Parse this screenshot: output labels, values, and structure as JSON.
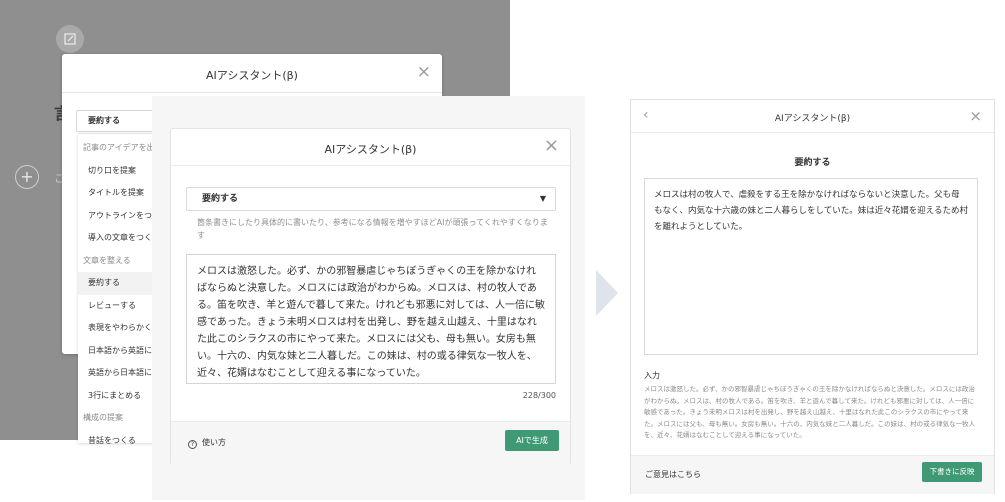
{
  "back": {
    "modal_title": "AIアシスタント(β)",
    "close": "×",
    "plus": "+",
    "editor_char": "言",
    "editor_char2": "こ",
    "select_value": "要約する",
    "dropdown": [
      {
        "type": "head",
        "label": "記事のアイデアを出す"
      },
      {
        "type": "item",
        "label": "切り口を提案"
      },
      {
        "type": "item",
        "label": "タイトルを提案"
      },
      {
        "type": "item",
        "label": "アウトラインをつくる"
      },
      {
        "type": "item",
        "label": "導入の文章をつくる"
      },
      {
        "type": "head",
        "label": "文章を整える"
      },
      {
        "type": "item",
        "label": "要約する",
        "active": true
      },
      {
        "type": "item",
        "label": "レビューする"
      },
      {
        "type": "item",
        "label": "表現をやわらかくする"
      },
      {
        "type": "item",
        "label": "日本語から英語に翻訳"
      },
      {
        "type": "item",
        "label": "英語から日本語に翻訳"
      },
      {
        "type": "item",
        "label": "3行にまとめる"
      },
      {
        "type": "head",
        "label": "構成の提案"
      },
      {
        "type": "item",
        "label": "昔話をつくる"
      }
    ]
  },
  "middle": {
    "title": "AIアシスタント(β)",
    "close": "×",
    "select_value": "要約する",
    "hint": "箇条書きにしたり具体的に書いたり、参考になる情報を増やすほどAIが頑張ってくれやすくなります",
    "input_text": "メロスは激怒した。必ず、かの邪智暴虐じゃちぼうぎゃくの王を除かなければならぬと決意した。メロスには政治がわからぬ。メロスは、村の牧人である。笛を吹き、羊と遊んで暮して来た。けれども邪悪に対しては、人一倍に敏感であった。きょう未明メロスは村を出発し、野を越え山越え、十里はなれた此このシラクスの市にやって来た。メロスには父も、母も無い。女房も無い。十六の、内気な妹と二人暮しだ。この妹は、村の或る律気な一牧人を、近々、花婿はなむことして迎える事になっていた。",
    "char_count": "228/300",
    "usage_label": "使い方",
    "usage_icon": "?",
    "generate_label": "AIで生成"
  },
  "right": {
    "back": "‹",
    "title": "AIアシスタント(β)",
    "close": "×",
    "subtitle": "要約する",
    "output_text": "メロスは村の牧人で、虐殺をする王を除かなければならないと決意した。父も母もなく、内気な十六歳の妹と二人暮らしをしていた。妹は近々花婿を迎えるため村を離れようとしていた。",
    "input_label": "入力",
    "input_text": "メロスは激怒した。必ず、かの邪智暴虐じゃちぼうぎゃくの王を除かなければならぬと決意した。メロスには政治がわからぬ。メロスは、村の牧人である。笛を吹き、羊と遊んで暮して来た。けれども邪悪に対しては、人一倍に敏感であった。きょう未明メロスは村を出発し、野を越え山越え、十里はなれた此このシラクスの市にやって来た。メロスには父も、母も無い。女房も無い。十六の、内気な妹と二人暮しだ。この妹は、村の或る律気な一牧人を、近々、花婿はなむことして迎える事になっていた。",
    "feedback_label": "ご意見はこちら",
    "apply_label": "下書きに反映"
  },
  "colors": {
    "accent": "#3f9a74",
    "overlay": "#8f8f8f"
  }
}
